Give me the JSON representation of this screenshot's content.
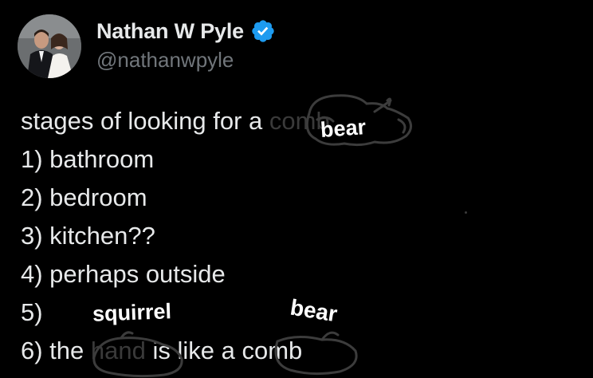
{
  "author": {
    "display_name": "Nathan W Pyle",
    "handle": "@nathanwpyle",
    "verified": true,
    "verified_icon": "verified-badge-icon",
    "verified_color": "#1d9bf0"
  },
  "tweet": {
    "lines": [
      "stages of looking for a",
      "1) bathroom",
      "2) bedroom",
      "3) kitchen??",
      "4) perhaps outside",
      "5)",
      "6) the"
    ],
    "line1_covered_word": "comb",
    "line7_hand_word": "hand",
    "line7_rest": " is like a",
    "line7_last_word": "comb"
  },
  "annotations": {
    "label_top": "bear",
    "label_squirrel": "squirrel",
    "label_bottom": "bear"
  },
  "colors": {
    "background": "#000000",
    "text": "#e7e9ea",
    "secondary_text": "#71767b",
    "annotation": "#ffffff"
  }
}
